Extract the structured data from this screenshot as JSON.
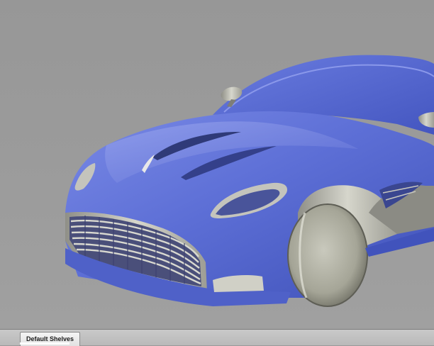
{
  "shelf": {
    "tab_label": "Default Shelves"
  },
  "viewport": {
    "subject": "car-model",
    "colors": {
      "background": "#9a9a9a",
      "body_blue": "#5a6cd8",
      "body_silver": "#c8c8c2",
      "grille_dark": "#4a4f7a"
    }
  }
}
